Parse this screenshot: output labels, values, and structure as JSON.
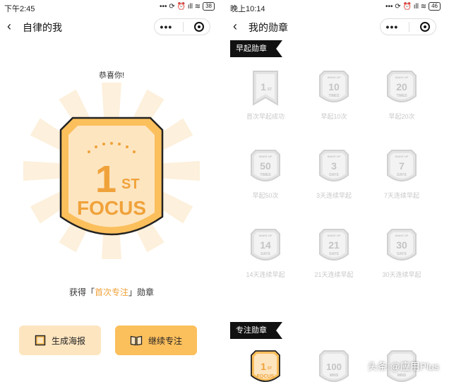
{
  "left": {
    "status": {
      "time": "下午2:45",
      "icons": "••• ⟳ ⏰ ıll ≋",
      "battery": "38"
    },
    "nav": {
      "title": "自律的我",
      "back": "‹",
      "menu": "•••"
    },
    "congrats": "恭喜你!",
    "badge": {
      "rank": "1",
      "suffix": "ST",
      "word": "FOCUS"
    },
    "award": {
      "prefix": "获得「",
      "highlight": "首次专注",
      "suffix": "」勋章"
    },
    "buttons": {
      "poster": "生成海报",
      "continue": "继续专注"
    },
    "colors": {
      "accent": "#f0a23a",
      "badge_fill": "#fbbf5c",
      "badge_light": "#fde5c0"
    }
  },
  "right": {
    "status": {
      "time": "晚上10:14",
      "icons": "••• ⟳ ⏰ ıll ≋",
      "battery": "46"
    },
    "nav": {
      "title": "我的勋章",
      "back": "‹",
      "menu": "•••"
    },
    "section_early": "早起勋章",
    "section_focus": "专注勋章",
    "early_badges": [
      {
        "top": "",
        "num": "1",
        "unit": "ST",
        "caption": "首次早起成功"
      },
      {
        "top": "WAKE UP",
        "num": "10",
        "unit": "TIMES",
        "caption": "早起10次"
      },
      {
        "top": "WAKE UP",
        "num": "20",
        "unit": "TIMES",
        "caption": "早起20次"
      },
      {
        "top": "WAKE UP",
        "num": "50",
        "unit": "TIMES",
        "caption": "早起50次"
      },
      {
        "top": "WAKE UP",
        "num": "3",
        "unit": "DAYS",
        "caption": "3天连续早起"
      },
      {
        "top": "WAKE UP",
        "num": "7",
        "unit": "DAYS",
        "caption": "7天连续早起"
      },
      {
        "top": "WAKE UP",
        "num": "14",
        "unit": "DAYS",
        "caption": "14天连续早起"
      },
      {
        "top": "WAKE UP",
        "num": "21",
        "unit": "DAYS",
        "caption": "21天连续早起"
      },
      {
        "top": "WAKE UP",
        "num": "30",
        "unit": "DAYS",
        "caption": "30天连续早起"
      }
    ],
    "focus_badges": [
      {
        "num": "1",
        "unit": "ST",
        "word": "FOCUS"
      },
      {
        "num": "100",
        "unit": "MINS"
      },
      {
        "num": "",
        "unit": "MINS"
      }
    ],
    "watermark": "头条 @应用Plus"
  }
}
